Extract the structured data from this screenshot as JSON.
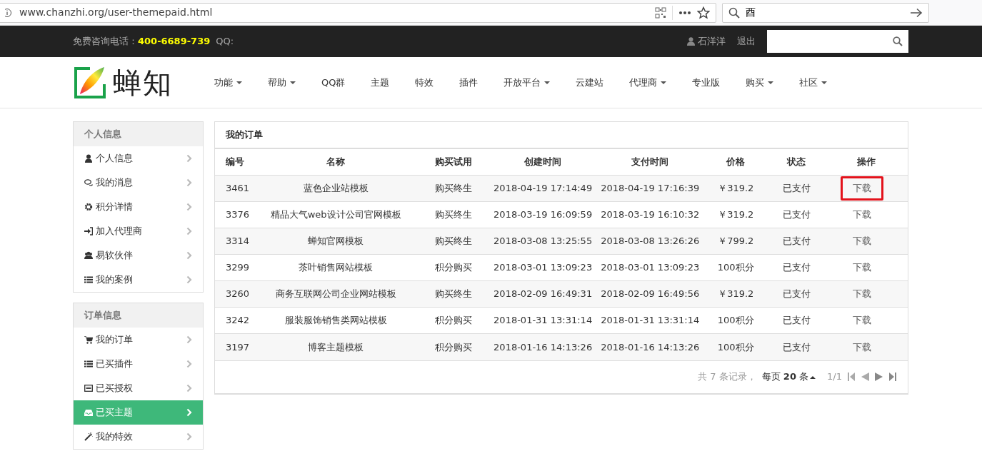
{
  "browser": {
    "url": "www.chanzhi.org/user-themepaid.html",
    "search_value": "酉"
  },
  "topbar": {
    "phone_label": "免费咨询电话：",
    "phone": "400-6689-739",
    "qq_label": "QQ:",
    "user": "石洋洋",
    "logout": "退出"
  },
  "logo": {
    "text": "蝉知"
  },
  "nav": [
    {
      "label": "功能",
      "dropdown": true
    },
    {
      "label": "帮助",
      "dropdown": true
    },
    {
      "label": "QQ群",
      "dropdown": false
    },
    {
      "label": "主题",
      "dropdown": false
    },
    {
      "label": "特效",
      "dropdown": false
    },
    {
      "label": "插件",
      "dropdown": false
    },
    {
      "label": "开放平台",
      "dropdown": true
    },
    {
      "label": "云建站",
      "dropdown": false
    },
    {
      "label": "代理商",
      "dropdown": true
    },
    {
      "label": "专业版",
      "dropdown": false
    },
    {
      "label": "购买",
      "dropdown": true
    },
    {
      "label": "社区",
      "dropdown": true
    }
  ],
  "sidebar": [
    {
      "title": "个人信息",
      "items": [
        {
          "label": "个人信息",
          "selected": false
        },
        {
          "label": "我的消息",
          "selected": false
        },
        {
          "label": "积分详情",
          "selected": false
        },
        {
          "label": "加入代理商",
          "selected": false
        },
        {
          "label": "易软伙伴",
          "selected": false
        },
        {
          "label": "我的案例",
          "selected": false
        }
      ]
    },
    {
      "title": "订单信息",
      "items": [
        {
          "label": "我的订单",
          "selected": false
        },
        {
          "label": "已买插件",
          "selected": false
        },
        {
          "label": "已买授权",
          "selected": false
        },
        {
          "label": "已买主题",
          "selected": true
        },
        {
          "label": "我的特效",
          "selected": false
        }
      ]
    }
  ],
  "orders": {
    "title": "我的订单",
    "columns": [
      "编号",
      "名称",
      "购买试用",
      "创建时间",
      "支付时间",
      "价格",
      "状态",
      "操作"
    ],
    "rows": [
      {
        "id": "3461",
        "name": "蓝色企业站模板",
        "type": "购买终生",
        "created": "2018-04-19 17:14:49",
        "paid": "2018-04-19 17:16:39",
        "price": "￥319.2",
        "status": "已支付",
        "action": "下载",
        "highlighted": true
      },
      {
        "id": "3376",
        "name": "精品大气web设计公司官网模板",
        "type": "购买终生",
        "created": "2018-03-19 16:09:59",
        "paid": "2018-03-19 16:10:32",
        "price": "￥319.2",
        "status": "已支付",
        "action": "下载",
        "highlighted": false
      },
      {
        "id": "3314",
        "name": "蝉知官网模板",
        "type": "购买终生",
        "created": "2018-03-08 13:25:55",
        "paid": "2018-03-08 13:26:26",
        "price": "￥799.2",
        "status": "已支付",
        "action": "下载",
        "highlighted": false
      },
      {
        "id": "3299",
        "name": "茶叶销售网站模板",
        "type": "积分购买",
        "created": "2018-03-01 13:09:23",
        "paid": "2018-03-01 13:09:23",
        "price": "100积分",
        "status": "已支付",
        "action": "下载",
        "highlighted": false
      },
      {
        "id": "3260",
        "name": "商务互联网公司企业网站模板",
        "type": "购买终生",
        "created": "2018-02-09 16:49:31",
        "paid": "2018-02-09 16:49:56",
        "price": "￥319.2",
        "status": "已支付",
        "action": "下载",
        "highlighted": false
      },
      {
        "id": "3242",
        "name": "服装服饰销售类网站模板",
        "type": "积分购买",
        "created": "2018-01-31 13:31:14",
        "paid": "2018-01-31 13:31:14",
        "price": "100积分",
        "status": "已支付",
        "action": "下载",
        "highlighted": false
      },
      {
        "id": "3197",
        "name": "博客主题模板",
        "type": "积分购买",
        "created": "2018-01-16 14:13:26",
        "paid": "2018-01-16 14:13:26",
        "price": "100积分",
        "status": "已支付",
        "action": "下载",
        "highlighted": false
      }
    ],
    "pager": {
      "total": "共 7 条记录，",
      "per_page_label": "每页",
      "per_page": "20",
      "unit": "条",
      "page": "1/1"
    }
  }
}
